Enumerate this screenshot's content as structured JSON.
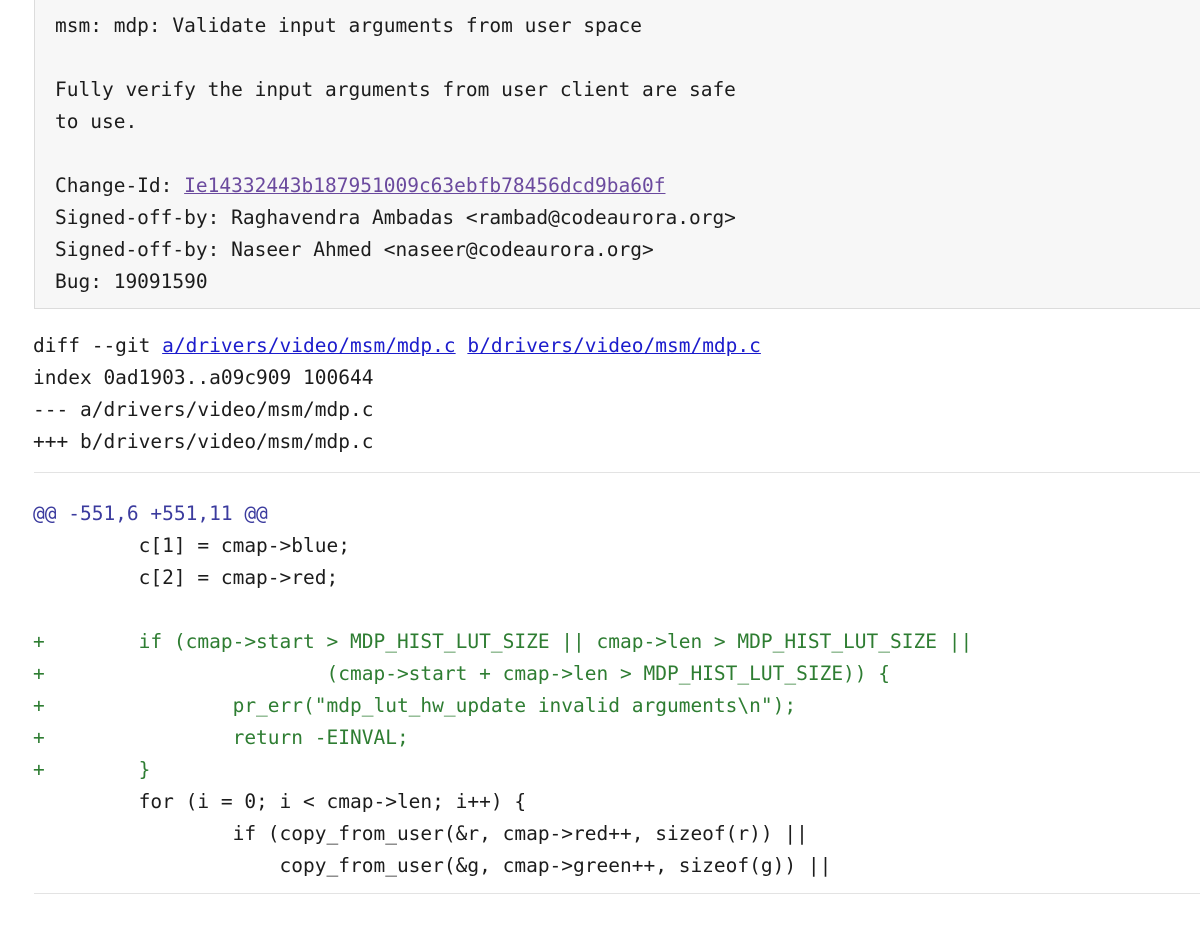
{
  "commit": {
    "subject": "msm: mdp: Validate input arguments from user space",
    "body_lines": [
      "Fully verify the input arguments from user client are safe",
      "to use."
    ],
    "change_id_label": "Change-Id: ",
    "change_id_value": "Ie14332443b187951009c63ebfb78456dcd9ba60f",
    "signed_off_by": [
      "Signed-off-by: Raghavendra Ambadas <rambad@codeaurora.org>",
      "Signed-off-by: Naseer Ahmed <naseer@codeaurora.org>"
    ],
    "bug": "Bug: 19091590"
  },
  "diff_header": {
    "diff_git_prefix": "diff --git ",
    "file_a": "a/drivers/video/msm/mdp.c",
    "file_separator": " ",
    "file_b": "b/drivers/video/msm/mdp.c",
    "index_line": "index 0ad1903..a09c909 100644",
    "minus_line": "--- a/drivers/video/msm/mdp.c",
    "plus_line": "+++ b/drivers/video/msm/mdp.c"
  },
  "hunk": {
    "header": "@@ -551,6 +551,11 @@",
    "lines": [
      {
        "type": "context",
        "text": "         c[1] = cmap->blue;"
      },
      {
        "type": "context",
        "text": "         c[2] = cmap->red;"
      },
      {
        "type": "blank",
        "text": " "
      },
      {
        "type": "added",
        "text": "+        if (cmap->start > MDP_HIST_LUT_SIZE || cmap->len > MDP_HIST_LUT_SIZE ||"
      },
      {
        "type": "added",
        "text": "+                        (cmap->start + cmap->len > MDP_HIST_LUT_SIZE)) {"
      },
      {
        "type": "added",
        "text": "+                pr_err(\"mdp_lut_hw_update invalid arguments\\n\");"
      },
      {
        "type": "added",
        "text": "+                return -EINVAL;"
      },
      {
        "type": "added",
        "text": "+        }"
      },
      {
        "type": "context",
        "text": "         for (i = 0; i < cmap->len; i++) {"
      },
      {
        "type": "context",
        "text": "                 if (copy_from_user(&r, cmap->red++, sizeof(r)) ||"
      },
      {
        "type": "context",
        "text": "                     copy_from_user(&g, cmap->green++, sizeof(g)) ||"
      }
    ]
  },
  "colors": {
    "added_green": "#2e7d32",
    "hunk_blue": "#3b3b9e",
    "file_link_blue": "#1c1ccc",
    "change_id_purple": "#6b4a9e",
    "panel_background": "#f7f7f7",
    "panel_border": "#dcdcdc",
    "divider": "#e3e3e3",
    "text": "#1c1c1c"
  }
}
